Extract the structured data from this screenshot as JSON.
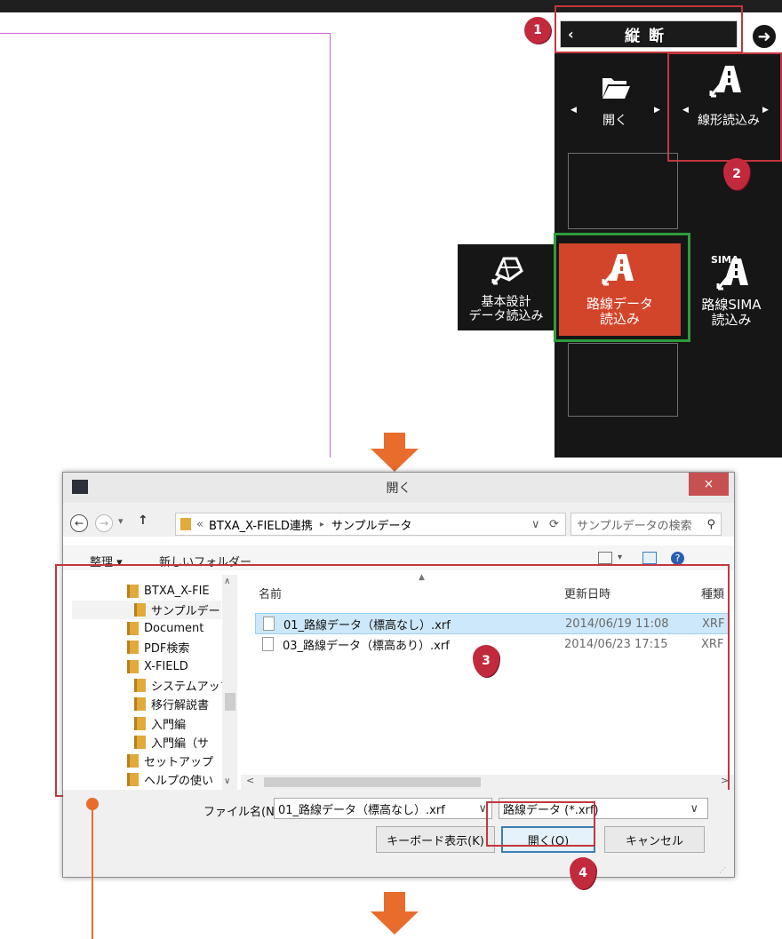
{
  "app": {
    "title_button": {
      "back": "‹",
      "label": "縦断"
    },
    "next_icon": "arrow-right-circle-icon",
    "tiles": {
      "open": {
        "label": "開く"
      },
      "senkei": {
        "label": "線形読込み"
      },
      "kihon": {
        "line1": "基本設計",
        "line2": "データ読込み"
      },
      "rosen": {
        "line1": "路線データ",
        "line2": "読込み"
      },
      "sima": {
        "badge": "SIMA",
        "line1": "路線SIMA",
        "line2": "読込み"
      }
    }
  },
  "steps": {
    "s1": "1",
    "s2": "2",
    "s3": "3",
    "s4": "4"
  },
  "dialog": {
    "title": "開く",
    "close": "×",
    "nav": {
      "back": "←",
      "forward": "→",
      "dropdown": "▾",
      "up": "↑"
    },
    "address": {
      "prefix": "«",
      "crumb1": "BTXA_X-FIELD連携",
      "sep": "▸",
      "crumb2": "サンプルデータ",
      "dropdown": "∨",
      "refresh": "⟳"
    },
    "search_placeholder": "サンプルデータの検索",
    "toolbar": {
      "organize": "整理 ▾",
      "new_folder": "新しいフォルダー",
      "help": "?"
    },
    "tree": [
      {
        "label": "BTXA_X-FIE"
      },
      {
        "label": "サンプルデー"
      },
      {
        "label": "Document"
      },
      {
        "label": "PDF検索"
      },
      {
        "label": "X-FIELD"
      },
      {
        "label": "システムアップ"
      },
      {
        "label": "移行解説書"
      },
      {
        "label": "入門編"
      },
      {
        "label": "入門編（サ"
      },
      {
        "label": "セットアップ"
      },
      {
        "label": "ヘルプの使い"
      }
    ],
    "columns": {
      "name": "名前",
      "date": "更新日時",
      "type": "種類"
    },
    "files": [
      {
        "name": "01_路線データ（標高なし）.xrf",
        "date": "2014/06/19 11:08",
        "type": "XRF"
      },
      {
        "name": "03_路線データ（標高あり）.xrf",
        "date": "2014/06/23 17:15",
        "type": "XRF"
      }
    ],
    "filename_label": "ファイル名(N):",
    "filename_value": "01_路線データ（標高なし）.xrf",
    "filter_value": "路線データ (*.xrf)",
    "buttons": {
      "keyboard": "キーボード表示(K)",
      "open": "開く(O)",
      "cancel": "キャンセル"
    }
  }
}
